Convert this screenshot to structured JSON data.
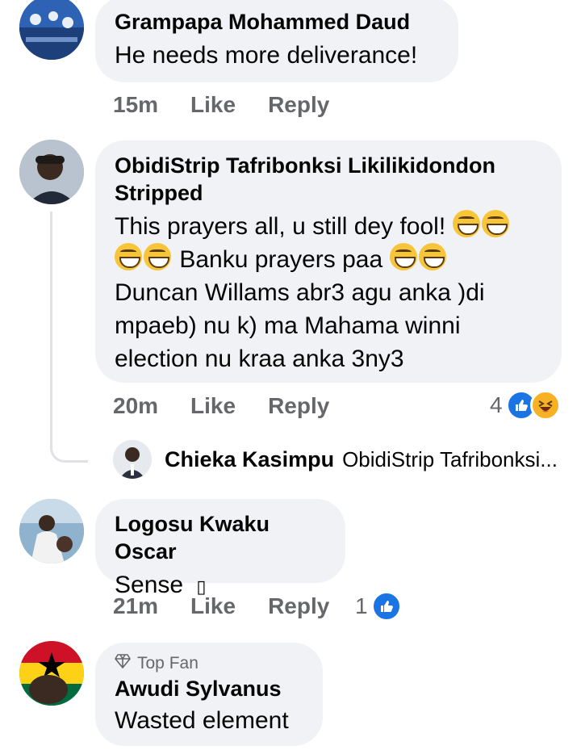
{
  "comments": [
    {
      "author": "Grampapa Mohammed Daud",
      "text": "He needs more deliverance!",
      "time": "15m",
      "like_label": "Like",
      "reply_label": "Reply"
    },
    {
      "author": "ObidiStrip Tafribonksi Likilikidondon Stripped",
      "lines": [
        "This prayers all, u still dey fool!",
        "Banku prayers paa",
        "Duncan Willams abr3 agu anka )di",
        "mpaeb) nu k) ma Mahama winni",
        "election nu kraa anka 3ny3"
      ],
      "time": "20m",
      "like_label": "Like",
      "reply_label": "Reply",
      "reaction_count": "4",
      "reply_preview": {
        "author": "Chieka Kasimpu",
        "snippet": "ObidiStrip Tafribonksi..."
      }
    },
    {
      "author": "Logosu Kwaku Oscar",
      "text": "Sense",
      "text_glyph": "▯",
      "time": "21m",
      "like_label": "Like",
      "reply_label": "Reply",
      "reaction_count": "1"
    },
    {
      "badge": "Top Fan",
      "author": "Awudi Sylvanus",
      "text": "Wasted element"
    }
  ],
  "icons": {
    "like": "thumbs-up-icon",
    "haha": "laughing-face-icon",
    "topfan": "diamond-badge-icon"
  },
  "colors": {
    "bubble": "#f0f2f5",
    "meta": "#65676b",
    "like_blue": "#1b74e4",
    "haha_yellow": "#f7b125"
  }
}
